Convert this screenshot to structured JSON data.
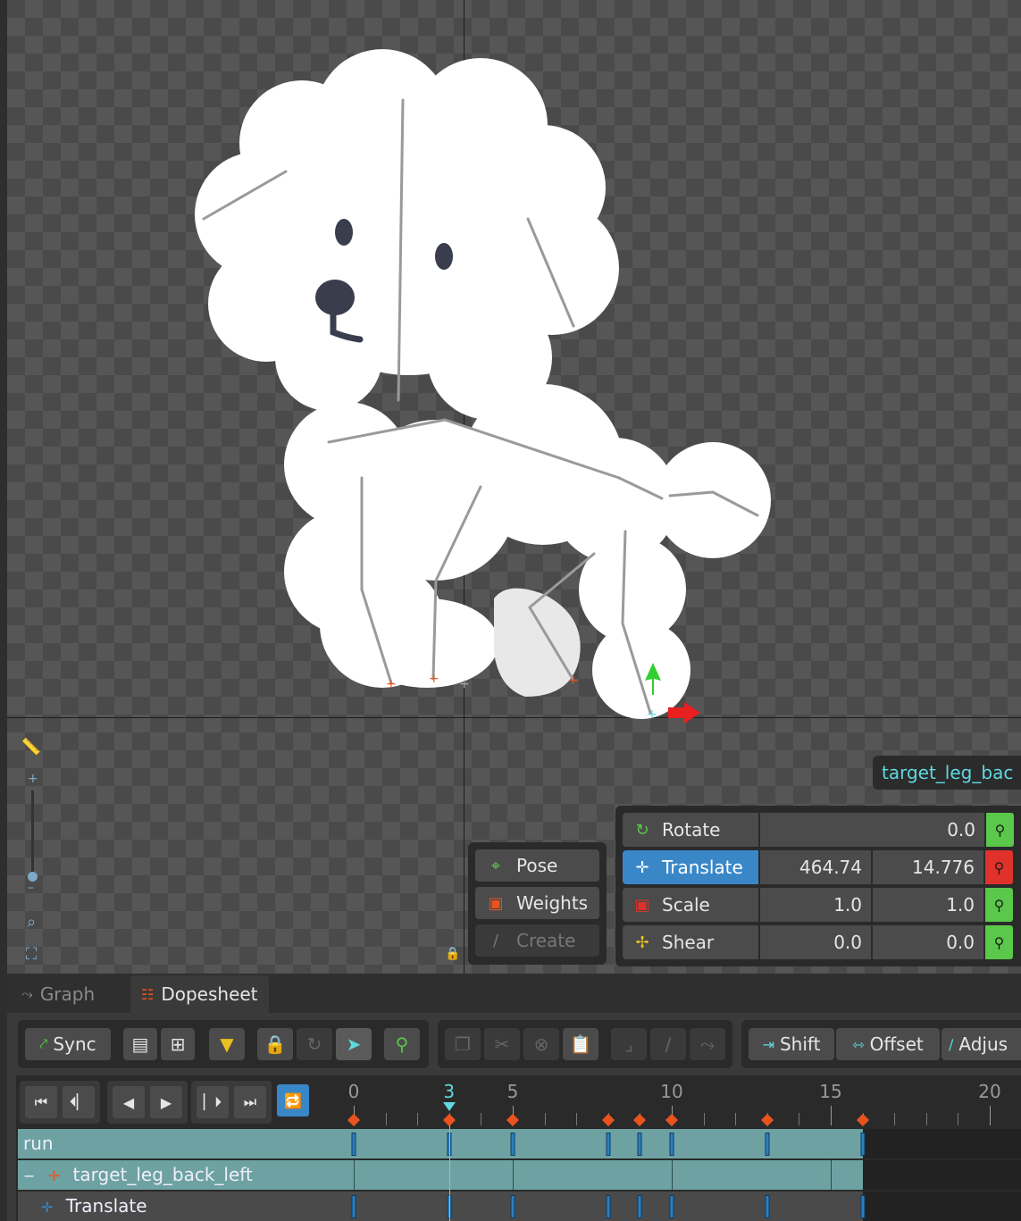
{
  "bone_tag": "target_leg_bac",
  "modes": {
    "pose": "Pose",
    "weights": "Weights",
    "create": "Create"
  },
  "transform": {
    "rotate": {
      "label": "Rotate",
      "value": "0.0"
    },
    "translate": {
      "label": "Translate",
      "x": "464.74",
      "y": "14.776"
    },
    "scale": {
      "label": "Scale",
      "x": "1.0",
      "y": "1.0"
    },
    "shear": {
      "label": "Shear",
      "x": "0.0",
      "y": "0.0"
    }
  },
  "tabs": {
    "graph": "Graph",
    "dopesheet": "Dopesheet"
  },
  "toolbar": {
    "sync": "Sync",
    "shift": "Shift",
    "offset": "Offset",
    "adjust": "Adjus"
  },
  "ruler": {
    "labels": [
      "0",
      "3",
      "5",
      "10",
      "15",
      "20"
    ],
    "current_frame": 3,
    "keyframes": [
      0,
      3,
      5,
      8,
      9,
      10,
      13,
      16
    ]
  },
  "tracks": {
    "animation": "run",
    "bone": "target_leg_back_left",
    "property": "Translate"
  },
  "colors": {
    "accent": "#3a87c8",
    "keyframe": "#e8531f",
    "playhead": "#5fd8e0",
    "track": "#6ea2a2"
  }
}
